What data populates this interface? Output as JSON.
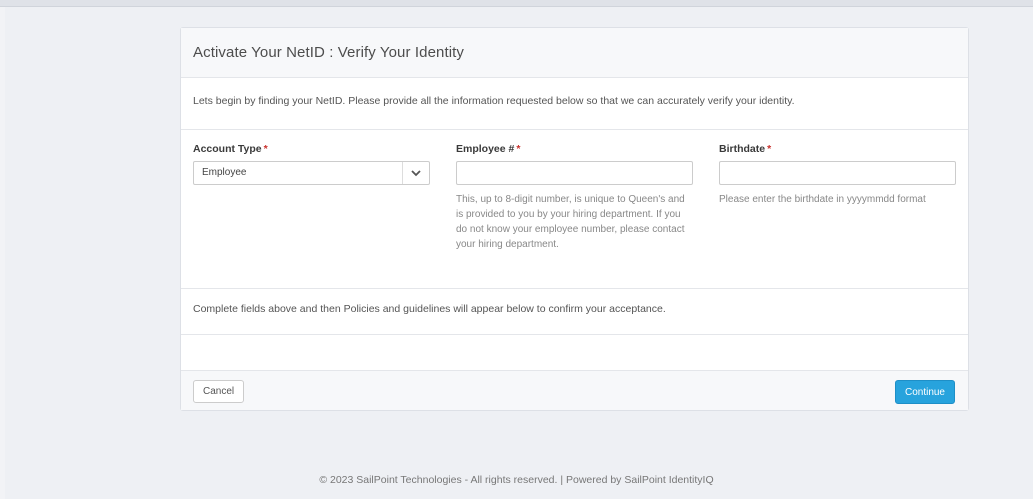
{
  "page": {
    "title": "Activate Your NetID : Verify Your Identity",
    "intro": "Lets begin by finding your NetID. Please provide all the information requested below so that we can accurately verify your identity."
  },
  "fields": {
    "account_type": {
      "label": "Account Type",
      "required_mark": "*",
      "value": "Employee"
    },
    "employee_number": {
      "label": "Employee #",
      "required_mark": "*",
      "value": "",
      "help": "This, up to 8-digit number, is unique to Queen's and is provided to you by your hiring department. If you do not know your employee number, please contact your hiring department."
    },
    "birthdate": {
      "label": "Birthdate",
      "required_mark": "*",
      "value": "",
      "help": "Please enter the birthdate in yyyymmdd format"
    }
  },
  "notice": "Complete fields above and then Policies and guidelines will appear below to confirm your acceptance.",
  "buttons": {
    "cancel": "Cancel",
    "continue": "Continue"
  },
  "footer": "© 2023 SailPoint Technologies - All rights reserved. | Powered by SailPoint IdentityIQ",
  "colors": {
    "primary": "#27a3dd",
    "required": "#c9302c",
    "background": "#eef0f4"
  },
  "icons": {
    "select_caret": "chevron-down-icon"
  }
}
